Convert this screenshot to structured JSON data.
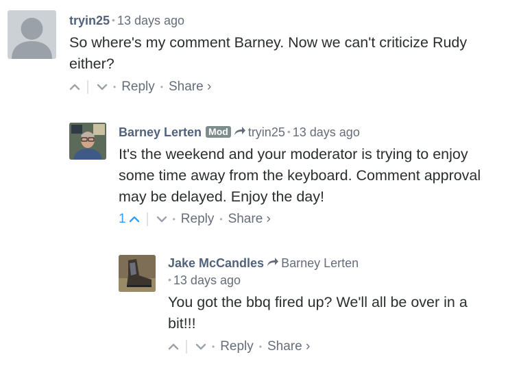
{
  "comments": [
    {
      "author": "tryin25",
      "time": "13 days ago",
      "text": "So where's my comment Barney. Now we can't criticize Rudy either?",
      "reply_label": "Reply",
      "share_label": "Share ›"
    },
    {
      "author": "Barney Lerten",
      "badge": "Mod",
      "in_reply_to": "tryin25",
      "time": "13 days ago",
      "text": "It's the weekend and your moderator is trying to enjoy some time away from the keyboard. Comment approval may be delayed. Enjoy the day!",
      "upvotes": "1",
      "reply_label": "Reply",
      "share_label": "Share ›"
    },
    {
      "author": "Jake McCandles",
      "in_reply_to": "Barney Lerten",
      "time": "13 days ago",
      "text": "You got the bbq fired up? We'll all be over in a bit!!!",
      "reply_label": "Reply",
      "share_label": "Share ›"
    }
  ],
  "separator_dot": "•",
  "colors": {
    "author": "#51627c",
    "meta": "#656c7a",
    "vote_count": "#2e9fff",
    "mod_badge": "#7f8c8d"
  }
}
